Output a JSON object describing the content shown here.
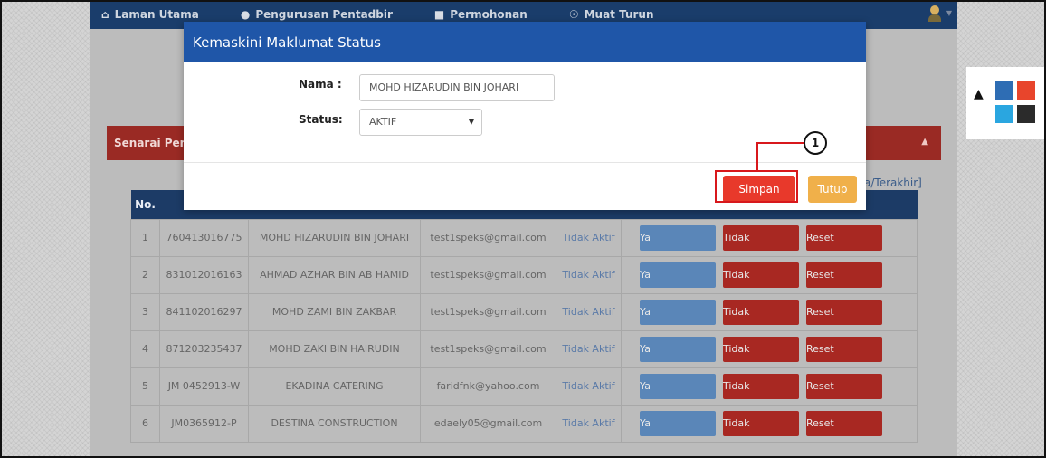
{
  "nav": {
    "items": [
      {
        "label": "Laman Utama",
        "icon": "home-icon"
      },
      {
        "label": "Pengurusan Pentadbir",
        "icon": "user-icon"
      },
      {
        "label": "Permohonan",
        "icon": "folder-icon"
      },
      {
        "label": "Muat Turun",
        "icon": "download-icon"
      }
    ]
  },
  "panel": {
    "title": "Senarai Pengguna",
    "link": "a/Terakhir]"
  },
  "table": {
    "headers": [
      "No.",
      "",
      "",
      "",
      "",
      ""
    ],
    "rows": [
      {
        "no": "1",
        "id": "760413016775",
        "name": "MOHD HIZARUDIN BIN JOHARI",
        "email": "test1speks@gmail.com",
        "status": "Tidak Aktif"
      },
      {
        "no": "2",
        "id": "831012016163",
        "name": "AHMAD AZHAR BIN AB HAMID",
        "email": "test1speks@gmail.com",
        "status": "Tidak Aktif"
      },
      {
        "no": "3",
        "id": "841102016297",
        "name": "MOHD ZAMI BIN ZAKBAR",
        "email": "test1speks@gmail.com",
        "status": "Tidak Aktif"
      },
      {
        "no": "4",
        "id": "871203235437",
        "name": "MOHD ZAKI BIN HAIRUDIN",
        "email": "test1speks@gmail.com",
        "status": "Tidak Aktif"
      },
      {
        "no": "5",
        "id": "JM 0452913-W",
        "name": "EKADINA CATERING",
        "email": "faridfnk@yahoo.com",
        "status": "Tidak Aktif"
      },
      {
        "no": "6",
        "id": "JM0365912-P",
        "name": "DESTINA CONSTRUCTION",
        "email": "edaely05@gmail.com",
        "status": "Tidak Aktif"
      }
    ],
    "btn_ya": "Ya",
    "btn_tidak": "Tidak",
    "btn_reset": "Reset"
  },
  "modal": {
    "title": "Kemaskini Maklumat Status",
    "nama_label": "Nama :",
    "nama_value": "MOHD HIZARUDIN BIN JOHARI",
    "status_label": "Status:",
    "status_value": "AKTIF",
    "save_label": "Simpan",
    "close_label": "Tutup"
  },
  "callout": {
    "number": "1"
  },
  "colors": {
    "navbar": "#1a3d6b",
    "modal_header": "#1f56a8",
    "save_button": "#e8392b",
    "close_button": "#f0b04a",
    "highlight": "#d8181c",
    "swatches": [
      "#2e6db4",
      "#e8452c",
      "#2aa6e0",
      "#2b2b2b"
    ]
  }
}
